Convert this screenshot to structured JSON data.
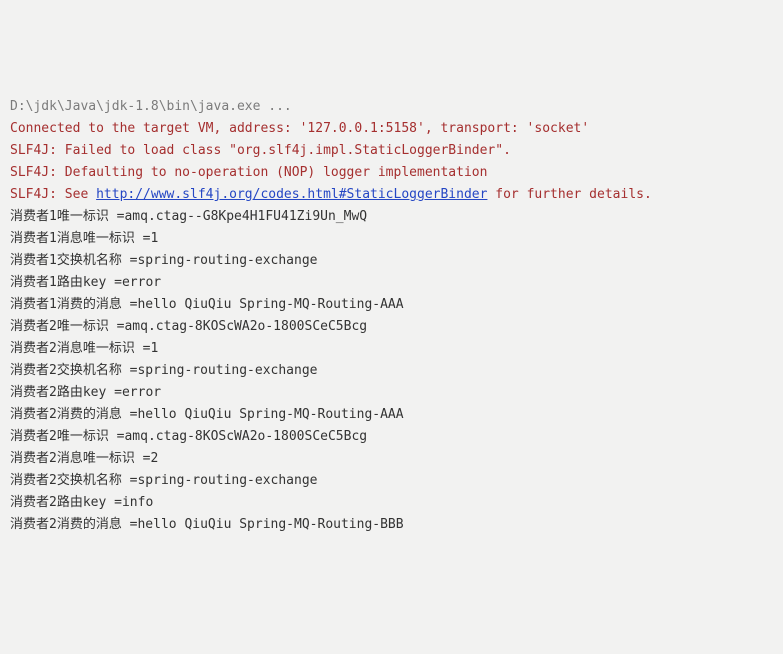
{
  "lines": [
    {
      "cls": "cmd",
      "text": "D:\\jdk\\Java\\jdk-1.8\\bin\\java.exe ..."
    },
    {
      "cls": "vm",
      "text": "Connected to the target VM, address: '127.0.0.1:5158', transport: 'socket'"
    },
    {
      "cls": "err",
      "text": "SLF4J: Failed to load class \"org.slf4j.impl.StaticLoggerBinder\"."
    },
    {
      "cls": "err",
      "text": "SLF4J: Defaulting to no-operation (NOP) logger implementation"
    },
    {
      "cls": "err",
      "prefix": "SLF4J: See ",
      "link": "http://www.slf4j.org/codes.html#StaticLoggerBinder",
      "suffix": " for further details."
    },
    {
      "cls": "txt",
      "text": "消费者1唯一标识 =amq.ctag--G8Kpe4H1FU41Zi9Un_MwQ"
    },
    {
      "cls": "txt",
      "text": "消费者1消息唯一标识 =1"
    },
    {
      "cls": "txt",
      "text": "消费者1交换机名称 =spring-routing-exchange"
    },
    {
      "cls": "txt",
      "text": "消费者1路由key =error"
    },
    {
      "cls": "txt",
      "text": "消费者1消费的消息 =hello QiuQiu Spring-MQ-Routing-AAA"
    },
    {
      "cls": "txt",
      "text": "消费者2唯一标识 =amq.ctag-8KOScWA2o-1800SCeC5Bcg"
    },
    {
      "cls": "txt",
      "text": "消费者2消息唯一标识 =1"
    },
    {
      "cls": "txt",
      "text": "消费者2交换机名称 =spring-routing-exchange"
    },
    {
      "cls": "txt",
      "text": "消费者2路由key =error"
    },
    {
      "cls": "txt",
      "text": "消费者2消费的消息 =hello QiuQiu Spring-MQ-Routing-AAA"
    },
    {
      "cls": "txt",
      "text": "消费者2唯一标识 =amq.ctag-8KOScWA2o-1800SCeC5Bcg"
    },
    {
      "cls": "txt",
      "text": "消费者2消息唯一标识 =2"
    },
    {
      "cls": "txt",
      "text": "消费者2交换机名称 =spring-routing-exchange"
    },
    {
      "cls": "txt",
      "text": "消费者2路由key =info"
    },
    {
      "cls": "txt",
      "text": "消费者2消费的消息 =hello QiuQiu Spring-MQ-Routing-BBB"
    }
  ]
}
